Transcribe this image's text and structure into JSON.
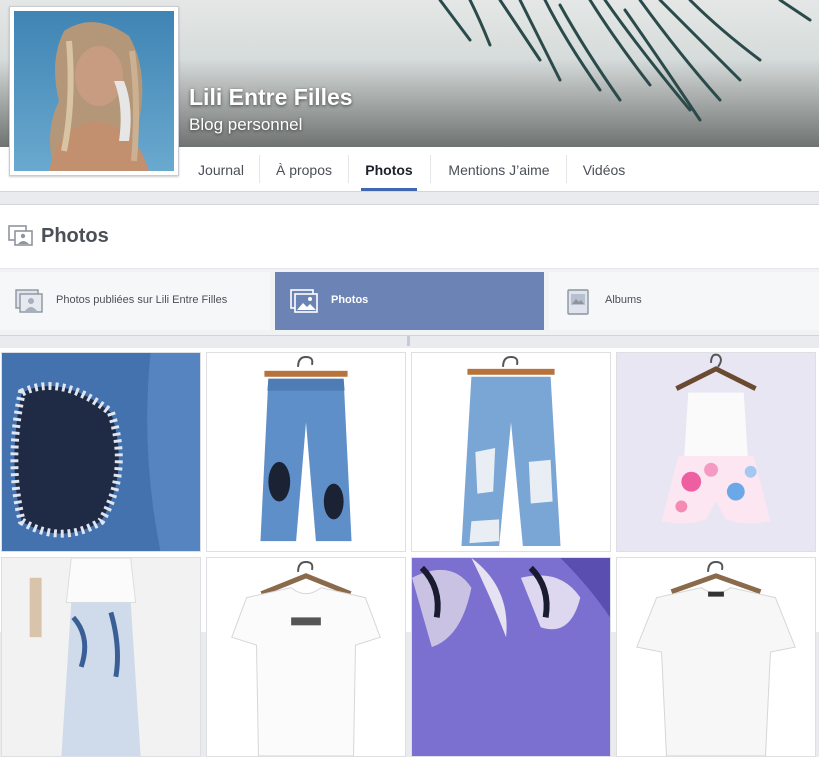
{
  "page": {
    "name": "Lili Entre Filles",
    "category": "Blog personnel"
  },
  "nav": {
    "tabs": [
      {
        "label": "Journal",
        "active": false
      },
      {
        "label": "À propos",
        "active": false
      },
      {
        "label": "Photos",
        "active": true
      },
      {
        "label": "Mentions J’aime",
        "active": false
      },
      {
        "label": "Vidéos",
        "active": false
      }
    ]
  },
  "section": {
    "title": "Photos"
  },
  "filters": [
    {
      "label": "Photos publiées sur Lili Entre Filles",
      "icon": "tagged-photos-icon",
      "active": false
    },
    {
      "label": "Photos",
      "icon": "photos-icon",
      "active": true
    },
    {
      "label": "Albums",
      "icon": "albums-icon",
      "active": false
    }
  ],
  "colors": {
    "accent": "#4267b2",
    "active_filter": "#6b84b5",
    "text": "#4b4f56"
  },
  "photos": [
    {
      "subject": "ripped denim close-up"
    },
    {
      "subject": "distressed blue jeans on hanger"
    },
    {
      "subject": "ripped light-blue jeans on hanger"
    },
    {
      "subject": "white lace floral romper on hanger"
    },
    {
      "subject": "white t-shirt and patterned trousers"
    },
    {
      "subject": "white t-shirt on hanger"
    },
    {
      "subject": "purple sequin fabric"
    },
    {
      "subject": "white top on hanger"
    }
  ]
}
